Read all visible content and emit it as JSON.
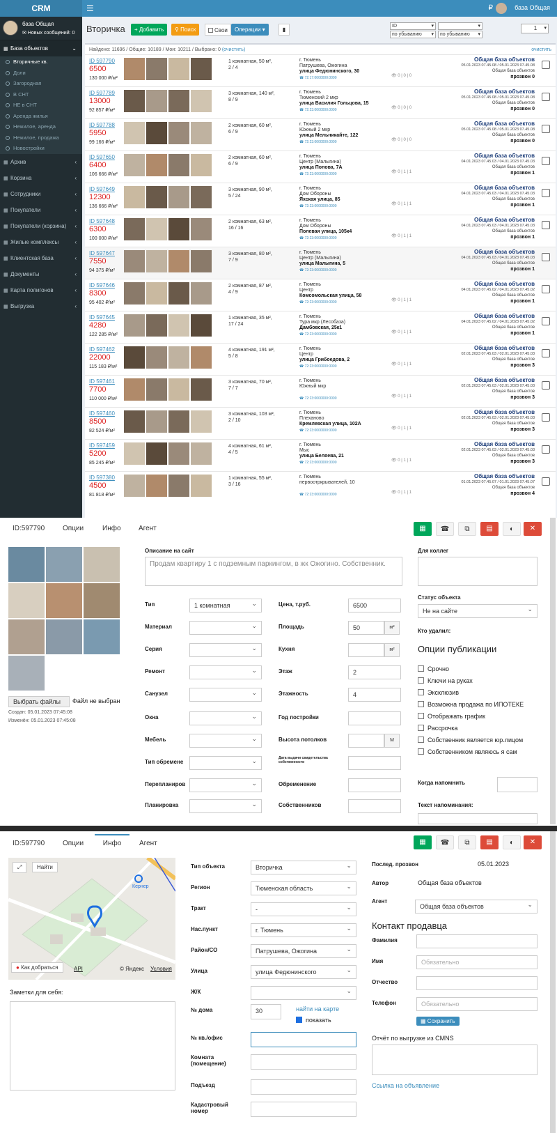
{
  "crm": {
    "logo": "CRM",
    "user": "база Общая",
    "messages": "Новых сообщений: 0",
    "topbar_user": "база Общая",
    "menu": [
      {
        "label": "База объектов",
        "icon": "◼"
      },
      {
        "label": "Архив",
        "icon": "◼"
      },
      {
        "label": "Корзина",
        "icon": "◼"
      },
      {
        "label": "Сотрудники",
        "icon": "◼"
      },
      {
        "label": "Покупатели",
        "icon": "◼"
      },
      {
        "label": "Покупатели (корзина)",
        "icon": "◼"
      },
      {
        "label": "Жилые комплексы",
        "icon": "◼"
      },
      {
        "label": "Клиентская база",
        "icon": "◼"
      },
      {
        "label": "Документы",
        "icon": "◼"
      },
      {
        "label": "Карта полигонов",
        "icon": "◼"
      },
      {
        "label": "Выгрузка",
        "icon": "◼"
      }
    ],
    "submenu": [
      "Вторичные кв.",
      "Доли",
      "Загородная",
      "В СНТ",
      "НЕ в СНТ",
      "Аренда жилья",
      "Нежилое, аренда",
      "Нежилое, продажа",
      "Новостройки"
    ],
    "page_title": "Вторичка",
    "btn_add": "+ Добавить",
    "btn_search": "Поиск",
    "chk_own": "Свои",
    "btn_ops": "Операции ▾",
    "sort_field": "ID",
    "sort_dir1": "по убыванию",
    "sort_dir2": "по убыванию",
    "page_num": "1",
    "found": "Найдено: 11696 / Общие: 10189 / Мои: 10211 / Выбрано: 0",
    "clear_link": "(очистить)",
    "clear_right": "очистить",
    "listings": [
      {
        "id": "ID 597790",
        "price": "6500",
        "sqm": "130 000 ₽/м²",
        "type": "1 комнатная, 50 м²,",
        "floor": "2 / 4",
        "city": "г. Тюмень",
        "district": "Патрушева, Ожогина",
        "street": "улица Федюнинского, 30",
        "tel": "☎ 72:17:0000000:0000",
        "eye": "👁 0 | 0 | 0",
        "base": "Общая база объектов",
        "dates": "05.01.2023 07.45.08 / 05.01.2023 07.45.08",
        "base2": "Общая база объектов",
        "call": "прозвон 0"
      },
      {
        "id": "ID 597789",
        "price": "13000",
        "sqm": "92 857 ₽/м²",
        "type": "3 комнатная, 140 м²,",
        "floor": "8 / 9",
        "city": "г. Тюмень",
        "district": "Тюменский 2 мкр",
        "street": "улица Василия Гольцова, 15",
        "tel": "☎ 72:23:0000000:0000",
        "eye": "👁 0 | 0 | 0",
        "base": "Общая база объектов",
        "dates": "05.01.2023 07.45.08 / 05.01.2023 07.45.08",
        "base2": "Общая база объектов",
        "call": "прозвон 0"
      },
      {
        "id": "ID 597788",
        "price": "5950",
        "sqm": "99 166 ₽/м²",
        "type": "2 комнатная, 60 м²,",
        "floor": "6 / 9",
        "city": "г. Тюмень",
        "district": "Южный 2 мкр",
        "street": "улица Мельникайте, 122",
        "tel": "☎ 72:23:0000000:0000",
        "eye": "👁 0 | 0 | 0",
        "base": "Общая база объектов",
        "dates": "05.01.2023 07.45.08 / 05.01.2023 07.45.08",
        "base2": "Общая база объектов",
        "call": "прозвон 0"
      },
      {
        "id": "ID 597650",
        "price": "6400",
        "sqm": "106 666 ₽/м²",
        "type": "2 комнатная, 60 м²,",
        "floor": "6 / 9",
        "city": "г. Тюмень",
        "district": "Центр (Малыгина)",
        "street": "улица Попова, 7А",
        "tel": "☎ 72:23:0000000:0000",
        "eye": "👁 0 | 1 | 1",
        "base": "Общая база объектов",
        "dates": "04.01.2023 07.45.03 / 04.01.2023 07.45.03",
        "base2": "Общая база объектов",
        "call": "прозвон 1"
      },
      {
        "id": "ID 597649",
        "price": "12300",
        "sqm": "136 666 ₽/м²",
        "type": "3 комнатная, 90 м²,",
        "floor": "5 / 24",
        "city": "г. Тюмень",
        "district": "Дом Обороны",
        "street": "Яхская улица, 85",
        "tel": "☎ 72:23:0000000:0000",
        "eye": "👁 0 | 1 | 1",
        "base": "Общая база объектов",
        "dates": "04.01.2023 07.45.03 / 04.01.2023 07.45.03",
        "base2": "Общая база объектов",
        "call": "прозвон 1"
      },
      {
        "id": "ID 597648",
        "price": "6300",
        "sqm": "100 000 ₽/м²",
        "type": "2 комнатная, 63 м²,",
        "floor": "16 / 16",
        "city": "г. Тюмень",
        "district": "Дом Обороны",
        "street": "Полевая улица, 105к4",
        "tel": "☎ 72:23:0000000:0000",
        "eye": "👁 0 | 1 | 1",
        "base": "Общая база объектов",
        "dates": "04.01.2023 07.45.03 / 04.01.2023 07.45.03",
        "base2": "Общая база объектов",
        "call": "прозвон 1"
      },
      {
        "id": "ID 597647",
        "price": "7550",
        "sqm": "94 375 ₽/м²",
        "type": "3 комнатная, 80 м²,",
        "floor": "7 / 9",
        "city": "г. Тюмень",
        "district": "Центр (Малыгина)",
        "street": "улица Малыгина, 5",
        "tel": "☎ 72:23:0000000:0000",
        "eye": "",
        "base": "Общая база объектов",
        "dates": "04.01.2023 07.45.03 / 04.01.2023 07.45.03",
        "base2": "Общая база объектов",
        "call": "прозвон 1"
      },
      {
        "id": "ID 597646",
        "price": "8300",
        "sqm": "95 402 ₽/м²",
        "type": "2 комнатная, 87 м²,",
        "floor": "4 / 9",
        "city": "г. Тюмень",
        "district": "Центр",
        "street": "Комсомольская улица, 58",
        "tel": "☎ 72:23:0000000:0000",
        "eye": "👁 0 | 1 | 1",
        "base": "Общая база объектов",
        "dates": "04.01.2023 07.45.02 / 04.01.2023 07.45.02",
        "base2": "Общая база объектов",
        "call": "прозвон 1"
      },
      {
        "id": "ID 597645",
        "price": "4280",
        "sqm": "122 285 ₽/м²",
        "type": "1 комнатная, 35 м²,",
        "floor": "17 / 24",
        "city": "г. Тюмень",
        "district": "Тура мкр (Лесобаза)",
        "street": "Дамбовская, 25к1",
        "tel": "☎ 72:23:0000000:0000",
        "eye": "👁 0 | 1 | 1",
        "base": "Общая база объектов",
        "dates": "04.01.2023 07.45.02 / 04.01.2023 07.45.02",
        "base2": "Общая база объектов",
        "call": "прозвон 1"
      },
      {
        "id": "ID 597462",
        "price": "22000",
        "sqm": "115 183 ₽/м²",
        "type": "4 комнатная, 191 м²,",
        "floor": "5 / 8",
        "city": "г. Тюмень",
        "district": "Центр",
        "street": "улица Грибоедова, 2",
        "tel": "☎ 72:23:0000000:0000",
        "eye": "👁 0 | 1 | 1",
        "base": "Общая база объектов",
        "dates": "02.01.2023 07.45.03 / 02.01.2023 07.45.03",
        "base2": "Общая база объектов",
        "call": "прозвон 3"
      },
      {
        "id": "ID 597461",
        "price": "7700",
        "sqm": "110 000 ₽/м²",
        "type": "3 комнатная, 70 м²,",
        "floor": "7 / 7",
        "city": "г. Тюмень",
        "district": "Южный мкр",
        "street": "",
        "tel": "☎ 72:23:0000000:0000",
        "eye": "👁 0 | 1 | 1",
        "base": "Общая база объектов",
        "dates": "02.01.2023 07.45.03 / 02.01.2023 07.45.03",
        "base2": "Общая база объектов",
        "call": "прозвон 3"
      },
      {
        "id": "ID 597460",
        "price": "8500",
        "sqm": "82 524 ₽/м²",
        "type": "3 комнатная, 103 м²,",
        "floor": "2 / 10",
        "city": "г. Тюмень",
        "district": "Плеханово",
        "street": "Кремлевская улица, 102А",
        "tel": "☎ 72:23:0000000:0000",
        "eye": "👁 0 | 1 | 1",
        "base": "Общая база объектов",
        "dates": "02.01.2023 07.45.03 / 02.01.2023 07.45.03",
        "base2": "Общая база объектов",
        "call": "прозвон 3"
      },
      {
        "id": "ID 597459",
        "price": "5200",
        "sqm": "85 245 ₽/м²",
        "type": "4 комнатная, 61 м²,",
        "floor": "4 / 5",
        "city": "г. Тюмень",
        "district": "Мыс",
        "street": "улица Беляева, 21",
        "tel": "☎ 72:23:0000000:0000",
        "eye": "👁 0 | 1 | 1",
        "base": "Общая база объектов",
        "dates": "02.01.2023 07.45.03 / 02.01.2023 07.45.03",
        "base2": "Общая база объектов",
        "call": "прозвон 3"
      },
      {
        "id": "ID 597380",
        "price": "4500",
        "sqm": "81 818 ₽/м²",
        "type": "1 комнатная, 55 м²,",
        "floor": "3 / 16",
        "city": "г. Тюмень",
        "district": "первоотркрывателей, 10",
        "street": "",
        "tel": "☎ 72:23:0000000:0000",
        "eye": "👁 0 | 1 | 1",
        "base": "Общая база объектов",
        "dates": "01.01.2023 07.45.07 / 01.01.2023 07.45.07",
        "base2": "Общая база объектов",
        "call": "прозвон 4"
      }
    ]
  },
  "form": {
    "tab_id": "ID:597790",
    "tab_opts": "Опции",
    "tab_info": "Инфо",
    "tab_agent": "Агент",
    "desc_label": "Описание на сайт",
    "desc_text": "Продам квартиру 1 с подземным паркингом, в жк Ожогино. Собственник.",
    "colleagues_label": "Для коллег",
    "status_label": "Статус объекта",
    "status_value": "Не на сайте",
    "deleted_label": "Кто удалил:",
    "pub_title": "Опции публикации",
    "pub_opts": [
      "Срочно",
      "Ключи на руках",
      "Эксклюзив",
      "Возможна продажа по ИПОТЕКЕ",
      "Отображать график",
      "Рассрочка",
      "Собственник является юр.лицом",
      "Собственником являюсь я сам"
    ],
    "remind_label": "Когда напомнить",
    "remind_text_label": "Текст напоминания:",
    "file_btn": "Выбрать файлы",
    "file_none": "Файл не выбран",
    "created": "Создан: 05.01.2023 07:45:08",
    "changed": "Изменён: 05.01.2023 07:45:08",
    "left_fields": [
      {
        "label": "Тип",
        "value": "1 комнатная"
      },
      {
        "label": "Материал",
        "value": ""
      },
      {
        "label": "Серия",
        "value": ""
      },
      {
        "label": "Ремонт",
        "value": ""
      },
      {
        "label": "Санузел",
        "value": ""
      },
      {
        "label": "Окна",
        "value": ""
      },
      {
        "label": "Мебель",
        "value": ""
      },
      {
        "label": "Тип обремене",
        "value": ""
      },
      {
        "label": "Перепланиров",
        "value": ""
      },
      {
        "label": "Планировка",
        "value": ""
      }
    ],
    "right_fields": [
      {
        "label": "Цена, т.руб.",
        "value": "6500",
        "unit": ""
      },
      {
        "label": "Площадь",
        "value": "50",
        "unit": "м²"
      },
      {
        "label": "Кухня",
        "value": "",
        "unit": "м²"
      },
      {
        "label": "Этаж",
        "value": "2",
        "unit": ""
      },
      {
        "label": "Этажность",
        "value": "4",
        "unit": ""
      },
      {
        "label": "Год постройки",
        "value": "",
        "unit": ""
      },
      {
        "label": "Высота потолков",
        "value": "",
        "unit": "М"
      },
      {
        "label": "Дата выдачи свидетельства собственности",
        "value": "",
        "unit": ""
      },
      {
        "label": "Обременение",
        "value": "",
        "unit": ""
      },
      {
        "label": "Собственников",
        "value": "",
        "unit": ""
      }
    ]
  },
  "info": {
    "map_find": "Найти",
    "map_route": "Как добраться",
    "map_api": "API",
    "map_copy": "© Яндекс",
    "map_terms": "Условия",
    "map_label_kerner": "Кернер",
    "notes_label": "Заметки для себя:",
    "fields": [
      {
        "label": "Тип объекта",
        "value": "Вторичка"
      },
      {
        "label": "Регион",
        "value": "Тюменская область"
      },
      {
        "label": "Тракт",
        "value": "-"
      },
      {
        "label": "Нас.пункт",
        "value": "г. Тюмень"
      },
      {
        "label": "Район/СО",
        "value": "Патрушева, Ожогина"
      },
      {
        "label": "Улица",
        "value": "улица Федюнинского"
      },
      {
        "label": "Ж/К",
        "value": ""
      }
    ],
    "house_label": "№ дома",
    "house_value": "30",
    "find_on_map": "найти на карте",
    "show": "показать",
    "flat_label": "№ кв./офис",
    "room_label": "Комната (помещение)",
    "entrance_label": "Подъезд",
    "cadastr_label": "Кадастровый номер",
    "last_call_label": "Послед. прозвон",
    "last_call_value": "05.01.2023",
    "author_label": "Автор",
    "author_value": "Общая база объектов",
    "agent_label": "Агент",
    "agent_value": "Общая база объектов",
    "seller_title": "Контакт продавца",
    "surname": "Фамилия",
    "name": "Имя",
    "name_ph": "Обязательно",
    "patronymic": "Отчество",
    "phone": "Телефон",
    "phone_ph": "Обязательно",
    "save": "Сохранить",
    "report_label": "Отчёт по выгрузке из CMNS",
    "ad_link": "Ссылка на объявление"
  }
}
